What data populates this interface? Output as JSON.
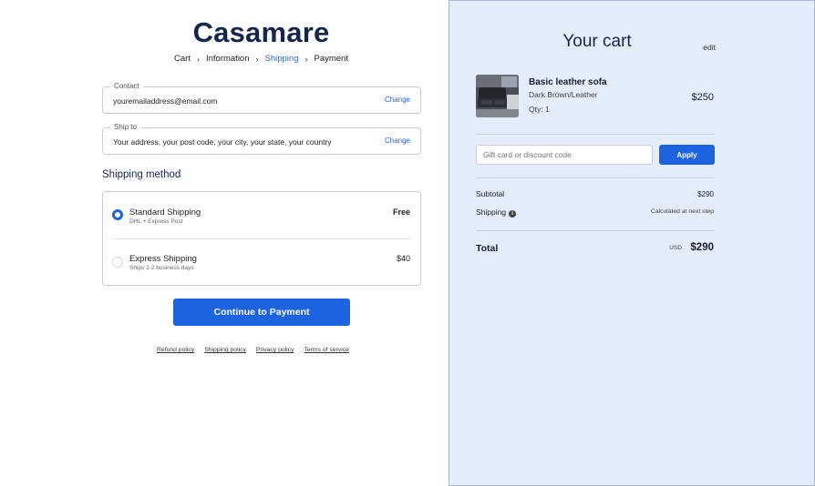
{
  "brand": {
    "name": "Casamare"
  },
  "breadcrumb": [
    "Cart",
    "Information",
    "Shipping",
    "Payment"
  ],
  "contact": {
    "label": "Contact",
    "value": "youremailaddress@email.com",
    "change_label": "Change"
  },
  "ship_to": {
    "label": "Ship to",
    "value": "Your address, your post code, your city, your state, your country",
    "change_label": "Change"
  },
  "shipping_method": {
    "title": "Shipping method",
    "options": [
      {
        "name": "Standard Shipping",
        "detail": "DHL + Express Post",
        "price": "Free",
        "selected": true
      },
      {
        "name": "Express Shipping",
        "detail": "Ships 1-2 business days",
        "price": "$40",
        "selected": false
      }
    ]
  },
  "continue_button": "Continue to Payment",
  "policies": [
    "Refund policy",
    "Shipping policy",
    "Privacy policy",
    "Terms of service"
  ],
  "cart": {
    "title": "Your cart",
    "edit_label": "edit",
    "item": {
      "name": "Basic leather sofa",
      "variant": "Dark Brown/Leather",
      "qty": "Qty: 1",
      "price": "$250",
      "image_icon": "sofa-photo"
    },
    "discount": {
      "placeholder": "Gift card or discount code",
      "apply_label": "Apply"
    },
    "subtotal": {
      "label": "Subtotal",
      "value": "$290"
    },
    "shipping": {
      "label": "Shipping",
      "value": "Calculated at next step",
      "info_icon": "info-icon"
    },
    "total": {
      "label": "Total",
      "currency": "USD",
      "value": "$290"
    }
  },
  "colors": {
    "accent": "#1d63e0",
    "brand": "#15264c",
    "cart_bg": "#e3edfb"
  }
}
